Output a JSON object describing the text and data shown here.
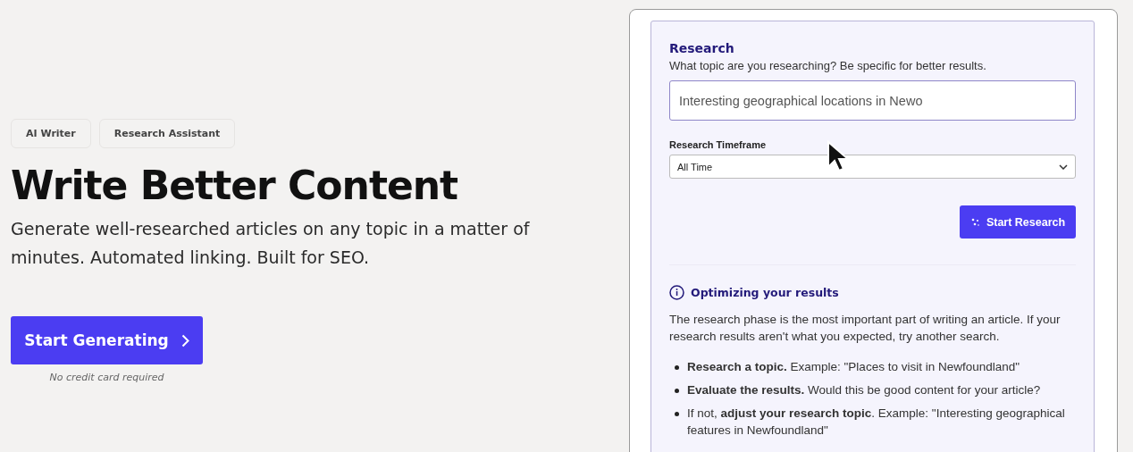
{
  "tags": [
    "AI Writer",
    "Research Assistant"
  ],
  "headline": "Write Better Content",
  "subtitle": "Generate well-researched articles on any topic in a matter of minutes. Automated linking. Built for SEO.",
  "cta": {
    "label": "Start Generating",
    "note": "No credit card required"
  },
  "preview": {
    "title": "Research",
    "prompt": "What topic are you researching? Be specific for better results.",
    "topic_input": {
      "value": "Interesting geographical locations in Newo"
    },
    "timeframe": {
      "label": "Research Timeframe",
      "value": "All Time"
    },
    "button": "Start Research",
    "tips": {
      "title": "Optimizing your results",
      "intro": "The research phase is the most important part of writing an article. If your research results aren't what you expected, try another search.",
      "items": [
        "**Research a topic.** Example: \"Places to visit in Newfoundland\"",
        "**Evaluate the results.** Would this be good content for your article?",
        "If not, **adjust your research topic**. Example: \"Interesting geographical features in Newfoundland\""
      ]
    }
  }
}
